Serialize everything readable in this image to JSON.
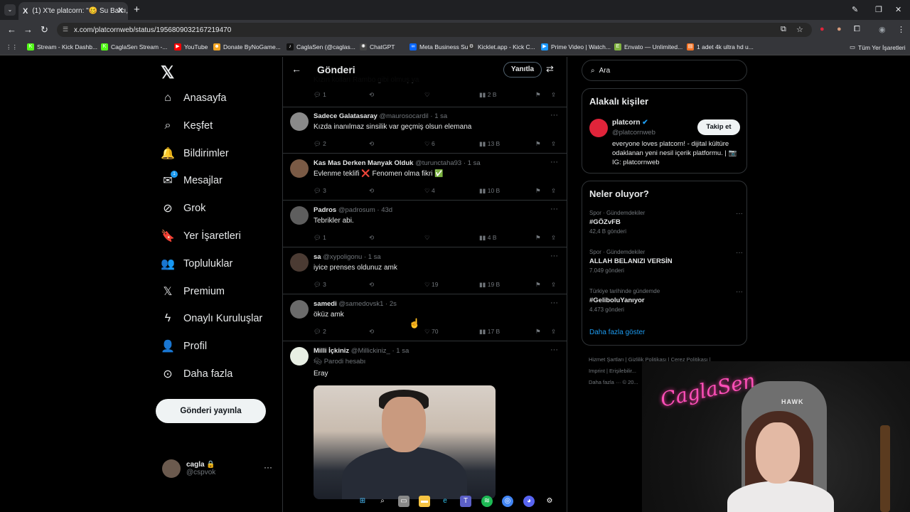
{
  "browser": {
    "tab_title": "(1) X'te platcorn: \"🥴 Su Balcı, l...",
    "tab_favicon": "X",
    "address": "x.com/platcornweb/status/1956809032167219470",
    "bookmarks": [
      {
        "label": "Stream - Kick Dashb...",
        "color": "#53fc18",
        "icon": "K"
      },
      {
        "label": "CaglaSen Stream -...",
        "color": "#53fc18",
        "icon": "K"
      },
      {
        "label": "YouTube",
        "color": "#ff0000",
        "icon": "▶"
      },
      {
        "label": "Donate ByNoGame...",
        "color": "#f5a623",
        "icon": "☻"
      },
      {
        "label": "CaglaSen (@caglas...",
        "color": "#111111",
        "icon": "♪"
      },
      {
        "label": "ChatGPT",
        "color": "#444444",
        "icon": "✺"
      },
      {
        "label": "Meta Business Suite",
        "color": "#0866ff",
        "icon": "∞"
      },
      {
        "label": "Kicklet.app - Kick C...",
        "color": "#333333",
        "icon": "⚙"
      },
      {
        "label": "Prime Video | Watch...",
        "color": "#1a98ff",
        "icon": "▶"
      },
      {
        "label": "Envato — Unlimited...",
        "color": "#82b541",
        "icon": "E"
      },
      {
        "label": "1 adet 4k ultra hd u...",
        "color": "#f57224",
        "icon": "▤"
      }
    ],
    "all_bookmarks": "Tüm Yer İşaretleri"
  },
  "sidebar": {
    "items": [
      {
        "label": "Anasayfa",
        "icon": "home-icon",
        "glyph": "⌂"
      },
      {
        "label": "Keşfet",
        "icon": "search-icon",
        "glyph": "⌕"
      },
      {
        "label": "Bildirimler",
        "icon": "bell-icon",
        "glyph": "🔔"
      },
      {
        "label": "Mesajlar",
        "icon": "mail-icon",
        "glyph": "✉"
      },
      {
        "label": "Grok",
        "icon": "grok-icon",
        "glyph": "⊘"
      },
      {
        "label": "Yer İşaretleri",
        "icon": "bookmark-icon",
        "glyph": "🔖"
      },
      {
        "label": "Topluluklar",
        "icon": "communities-icon",
        "glyph": "👥"
      },
      {
        "label": "Premium",
        "icon": "x-premium-icon",
        "glyph": "𝕏"
      },
      {
        "label": "Onaylı Kuruluşlar",
        "icon": "lightning-icon",
        "glyph": "ϟ"
      },
      {
        "label": "Profil",
        "icon": "profile-icon",
        "glyph": "👤"
      },
      {
        "label": "Daha fazla",
        "icon": "more-circle-icon",
        "glyph": "⊙"
      }
    ],
    "messages_badge": "1",
    "post_button": "Gönderi yayınla",
    "user_name": "cagla 🔒",
    "user_handle": "@cspvok"
  },
  "main": {
    "title": "Gönderi",
    "reply_button": "Yanıtla",
    "partial_text": "Kızın kolları Rambo gibi olmuş ya",
    "partial_actions": {
      "replies": "1",
      "likes": "",
      "views": "2 B"
    },
    "tweets": [
      {
        "name": "Sadece Galatasaray",
        "handle": "@maurosocardil",
        "time": "1 sa",
        "text": "Kızda inanılmaz sinsilik var geçmiş olsun elemana",
        "replies": "2",
        "retweets": "",
        "likes": "6",
        "views": "13 B",
        "avatar_color": "#8a8a8a"
      },
      {
        "name": "Kas Mas Derken Manyak Olduk",
        "handle": "@turunctaha93",
        "time": "1 sa",
        "text": "Evlenme teklifi ❌ Fenomen olma fikri ✅",
        "replies": "3",
        "retweets": "",
        "likes": "4",
        "views": "10 B",
        "avatar_color": "#7a5a45"
      },
      {
        "name": "Padros",
        "handle": "@padrosum",
        "time": "43d",
        "text": "Tebrikler abi.",
        "replies": "1",
        "retweets": "",
        "likes": "",
        "views": "4 B",
        "avatar_color": "#5e5e5e"
      },
      {
        "name": "sa",
        "handle": "@xypoligonu",
        "time": "1 sa",
        "text": "iyice prenses oldunuz amk",
        "replies": "3",
        "retweets": "",
        "likes": "19",
        "views": "19 B",
        "avatar_color": "#4b3b33"
      },
      {
        "name": "samedi",
        "handle": "@samedovsk1",
        "time": "2s",
        "text": "öküz amk",
        "replies": "2",
        "retweets": "",
        "likes": "70",
        "views": "17 B",
        "avatar_color": "#6b6b6b"
      }
    ],
    "last_tweet": {
      "name": "Milli İçkiniz",
      "handle": "@Millickiniz_",
      "time": "1 sa",
      "label": "Parodi hesabı",
      "text": "Eray"
    }
  },
  "right": {
    "search_placeholder": "Ara",
    "related_title": "Alakalı kişiler",
    "related_name": "platcorn",
    "related_handle": "@platcornweb",
    "follow_button": "Takip et",
    "related_bio": "everyone loves platcorn! - dijital kültüre odaklanan yeni nesil içerik platformu. | 📷 IG: platcornweb",
    "trends_title": "Neler oluyor?",
    "trends": [
      {
        "category": "Spor · Gündemdekiler",
        "title": "#GÖZvFB",
        "count": "42,4 B gönderi"
      },
      {
        "category": "Spor · Gündemdekiler",
        "title": "ALLAH BELANIZI VERSİN",
        "count": "7.049 gönderi"
      },
      {
        "category": "Türkiye tarihinde gündemde",
        "title": "#GeliboluYanıyor",
        "count": "4.473 gönderi"
      }
    ],
    "show_more": "Daha fazla göster",
    "footer_line1": "Hizmet Şartları  |  Gizlilik Politikası  |  Çerez Politikası  |",
    "footer_line2": "Imprint  |  Erişilebilir...",
    "footer_line3": "Daha fazla ···  © 20..."
  },
  "overlay": {
    "neon_sign": "CaglaSen",
    "chair_brand": "HAWK"
  }
}
